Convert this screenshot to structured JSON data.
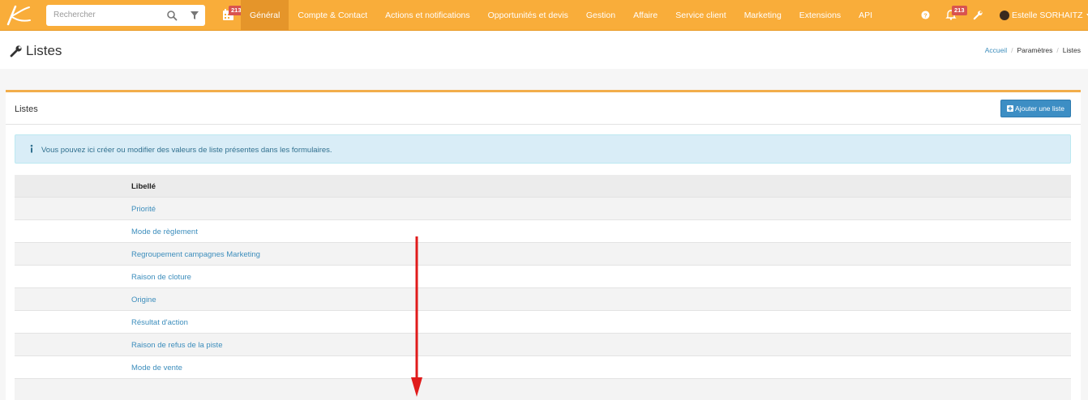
{
  "navbar": {
    "search_placeholder": "Rechercher",
    "calendar_badge": "213",
    "notif_badge": "213",
    "items": [
      {
        "label": "Général",
        "active": true
      },
      {
        "label": "Compte & Contact"
      },
      {
        "label": "Actions et notifications"
      },
      {
        "label": "Opportunités et devis"
      },
      {
        "label": "Gestion"
      },
      {
        "label": "Affaire"
      },
      {
        "label": "Service client"
      },
      {
        "label": "Marketing"
      },
      {
        "label": "Extensions"
      },
      {
        "label": "API"
      }
    ],
    "user_name": "Estelle SORHAITZ"
  },
  "page": {
    "title": "Listes",
    "breadcrumb": [
      "Accueil",
      "Paramètres",
      "Listes"
    ]
  },
  "box": {
    "title": "Listes",
    "add_button": "Ajouter une liste",
    "info": "Vous pouvez ici créer ou modifier des valeurs de liste présentes dans les formulaires."
  },
  "table": {
    "header": "Libellé",
    "rows": [
      "Priorité",
      "Mode de règlement",
      "Regroupement campagnes Marketing",
      "Raison de cloture",
      "Origine",
      "Résultat d'action",
      "Raison de refus de la piste",
      "Mode de vente"
    ]
  },
  "colors": {
    "navbar": "#f9ad3a",
    "nav_active": "#e5952a",
    "link": "#3c8dbc",
    "button": "#3d8ec4",
    "badge": "#d9534f",
    "arrow": "#e01b1b"
  },
  "icons": [
    "logo-icon",
    "search-icon",
    "filter-icon",
    "calendar-icon",
    "help-icon",
    "bell-icon",
    "wrench-icon",
    "plus-square-icon",
    "info-icon",
    "arrow-down-icon"
  ]
}
